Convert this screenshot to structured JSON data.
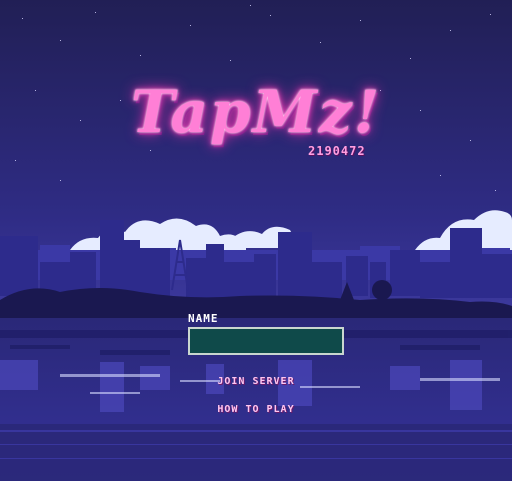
{
  "game": {
    "logo_text": "TapMz!",
    "version": "2190472"
  },
  "form": {
    "name_label": "NAME",
    "name_value": "",
    "name_placeholder": ""
  },
  "menu": {
    "join_label": "JOIN SERVER",
    "how_label": "HOW TO PLAY"
  },
  "colors": {
    "sky_top": "#25225e",
    "sky_bottom": "#4a46b8",
    "city": "#2b2a86",
    "water": "#2e2c80",
    "logo_pink": "#ff7fd6",
    "input_bg": "#0f4a4a"
  }
}
